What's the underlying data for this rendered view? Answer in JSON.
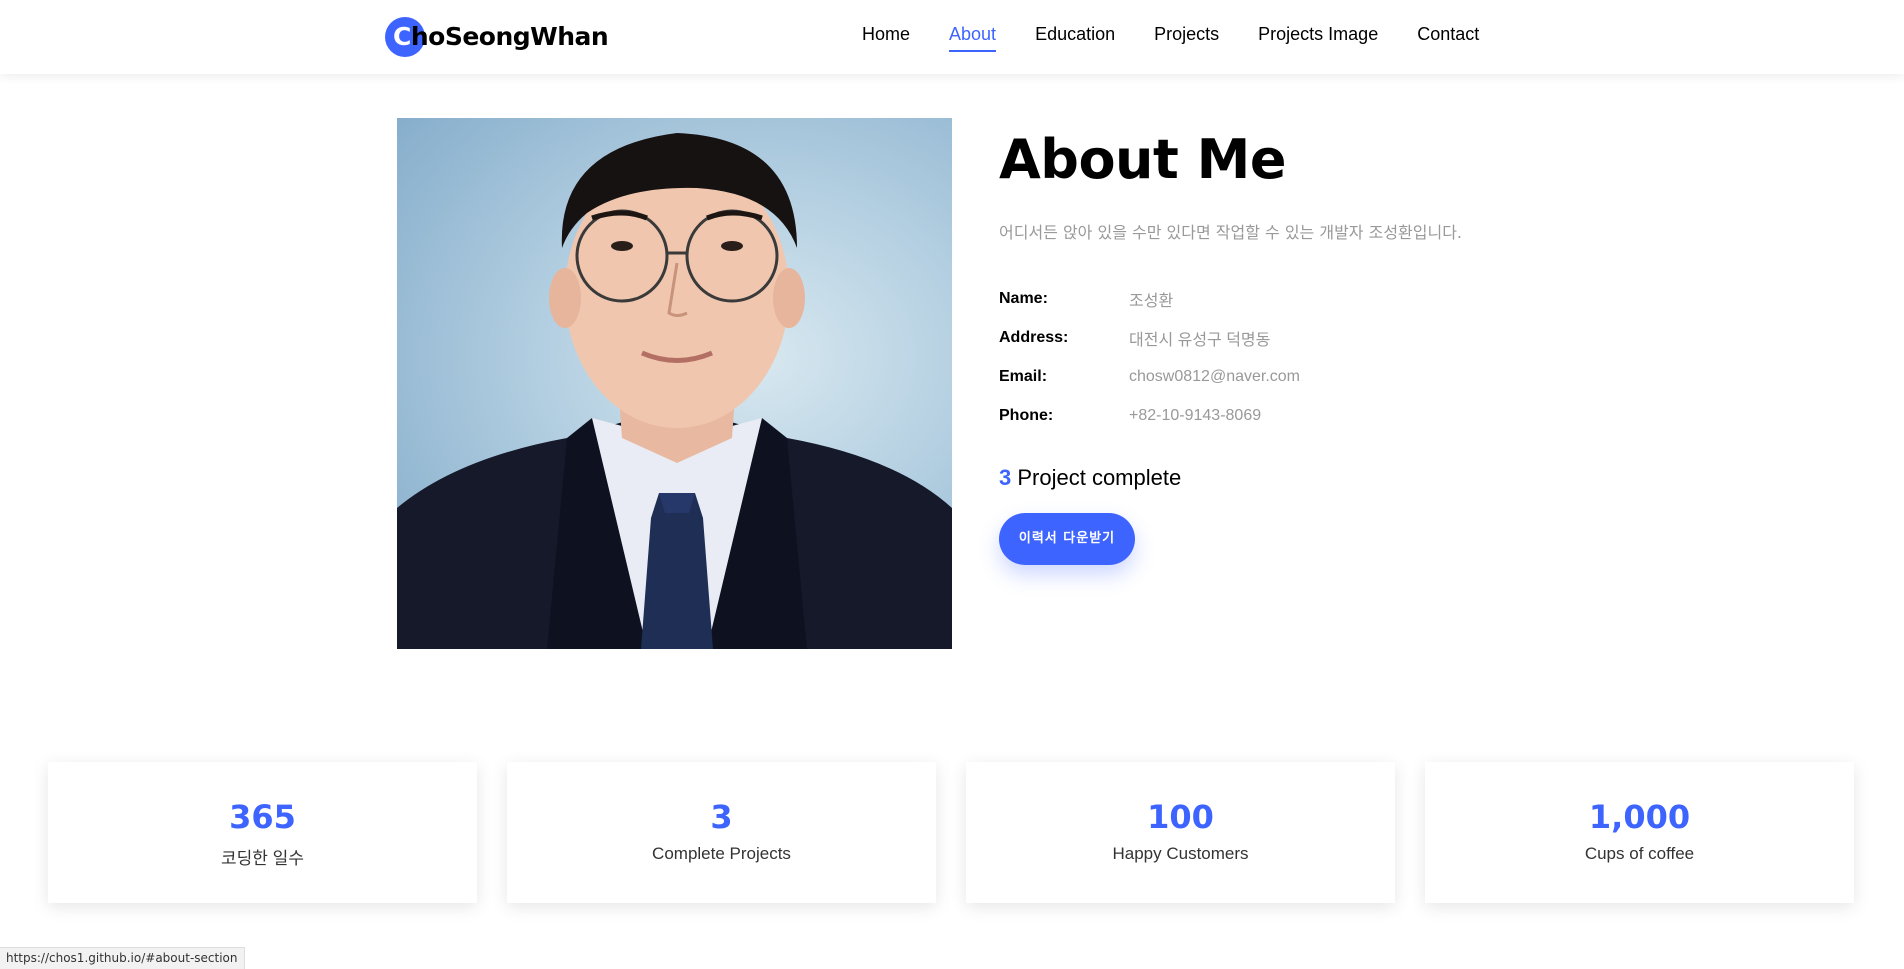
{
  "brand": {
    "first_letter": "C",
    "rest": "hoSeongWhan"
  },
  "nav": {
    "items": [
      "Home",
      "About",
      "Education",
      "Projects",
      "Projects Image",
      "Contact"
    ],
    "active": "About"
  },
  "about": {
    "title": "About Me",
    "description": "어디서든 앉아 있을 수만 있다면 작업할 수 있는 개발자 조성환입니다.",
    "info": [
      {
        "label": "Name:",
        "value": "조성환"
      },
      {
        "label": "Address:",
        "value": "대전시 유성구 덕명동"
      },
      {
        "label": "Email:",
        "value": "chosw0812@naver.com"
      },
      {
        "label": "Phone:",
        "value": "+82-10-9143-8069"
      }
    ],
    "projects_number": "3",
    "projects_text": " Project complete",
    "cv_button": "이력서 다운받기"
  },
  "counters": [
    {
      "number": "365",
      "label": "코딩한 일수"
    },
    {
      "number": "3",
      "label": "Complete Projects"
    },
    {
      "number": "100",
      "label": "Happy Customers"
    },
    {
      "number": "1,000",
      "label": "Cups of coffee"
    }
  ],
  "statusbar": {
    "url": "https://chos1.github.io/#about-section"
  },
  "colors": {
    "accent": "#3e64ff",
    "muted_text": "#999999"
  }
}
